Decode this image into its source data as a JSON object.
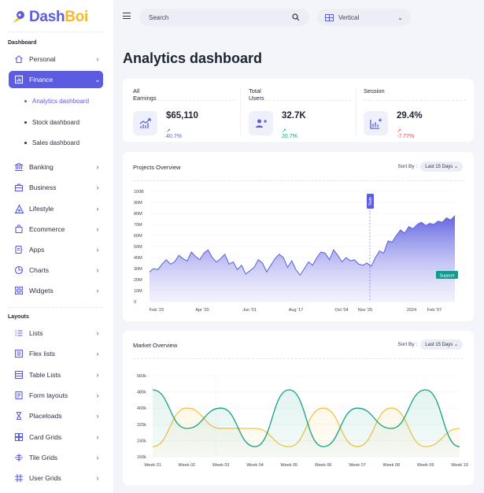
{
  "brand": {
    "name_main": "Dash",
    "name_accent": "Boi"
  },
  "sidebar": {
    "section_dashboard": "Dashboard",
    "section_layouts": "Layouts",
    "items": [
      {
        "label": "Personal",
        "icon": "home-icon"
      },
      {
        "label": "Finance",
        "icon": "chart-box-icon"
      },
      {
        "label": "Banking",
        "icon": "bank-icon"
      },
      {
        "label": "Business",
        "icon": "briefcase-icon"
      },
      {
        "label": "Lifestyle",
        "icon": "puzzle-icon"
      },
      {
        "label": "Ecommerce",
        "icon": "bag-icon"
      },
      {
        "label": "Apps",
        "icon": "apps-icon"
      },
      {
        "label": "Charts",
        "icon": "pie-icon"
      },
      {
        "label": "Widgets",
        "icon": "widgets-icon"
      }
    ],
    "finance_sub": [
      {
        "label": "Analytics dashboard"
      },
      {
        "label": "Stock dashboard"
      },
      {
        "label": "Sales dashboard"
      }
    ],
    "layout_items": [
      {
        "label": "Lists",
        "icon": "list-icon"
      },
      {
        "label": "Flex lists",
        "icon": "flex-list-icon"
      },
      {
        "label": "Table Lists",
        "icon": "table-icon"
      },
      {
        "label": "Form layouts",
        "icon": "form-icon"
      },
      {
        "label": "Placeloads",
        "icon": "hourglass-icon"
      },
      {
        "label": "Card Grids",
        "icon": "card-grid-icon"
      },
      {
        "label": "Tile Grids",
        "icon": "tile-grid-icon"
      },
      {
        "label": "User Grids",
        "icon": "user-grid-icon"
      }
    ]
  },
  "topbar": {
    "search_placeholder": "Search",
    "layout_value": "Vertical"
  },
  "page_title": "Analytics dashboard",
  "stats": [
    {
      "title": "All Earnings",
      "value": "$65,110",
      "change": "40.7%",
      "trend": "up",
      "color": "#5b5ce0"
    },
    {
      "title": "Total Users",
      "value": "32.7K",
      "change": "20.7%",
      "trend": "up",
      "color": "#1aa37a"
    },
    {
      "title": "Session",
      "value": "29.4%",
      "change": "-7.77%",
      "trend": "down",
      "color": "#ef4d4d"
    }
  ],
  "projects": {
    "title": "Projects Overview",
    "sort_label": "Sort By :",
    "sort_value": "Last 15 Days",
    "annotation_sale": "Sale",
    "annotation_support": "Support",
    "y_ticks": [
      "100B",
      "90M",
      "80M",
      "70M",
      "60M",
      "50M",
      "40M",
      "30M",
      "20M",
      "10M",
      "0"
    ],
    "x_ticks": [
      "Feb '23",
      "Apr '20",
      "Jun '01",
      "Aug '17",
      "Oct '04",
      "Nov '25",
      "2024",
      "Feb '07"
    ]
  },
  "market": {
    "title": "Market Overview",
    "sort_label": "Sort By :",
    "sort_value": "Last 15 Days",
    "y_ticks": [
      "560k",
      "480k",
      "400k",
      "320k",
      "240k",
      "160k"
    ],
    "x_ticks": [
      "Week 01",
      "Week 02",
      "Week 03",
      "Week 04",
      "Week 05",
      "Week 06",
      "Week 07",
      "Week 08",
      "Week 09",
      "Week 10"
    ]
  },
  "chart_data": [
    {
      "type": "area",
      "title": "Projects Overview",
      "ylim": [
        0,
        100
      ],
      "y_unit": "M",
      "x_labels": [
        "Feb '23",
        "Apr '20",
        "Jun '01",
        "Aug '17",
        "Oct '04",
        "Nov '25",
        "2024",
        "Feb '07"
      ],
      "values": [
        27,
        30,
        29,
        34,
        38,
        34,
        36,
        42,
        39,
        37,
        45,
        41,
        38,
        44,
        47,
        40,
        36,
        39,
        43,
        34,
        36,
        29,
        33,
        25,
        28,
        31,
        38,
        35,
        27,
        33,
        39,
        43,
        40,
        31,
        37,
        29,
        24,
        30,
        36,
        33,
        40,
        45,
        44,
        38,
        47,
        42,
        36,
        40,
        37,
        38,
        34,
        33,
        35,
        32,
        40,
        46,
        44,
        55,
        54,
        60,
        65,
        62,
        68,
        66,
        70,
        72,
        69,
        71,
        70,
        73,
        72,
        76,
        74,
        78
      ]
    },
    {
      "type": "area",
      "title": "Market Overview",
      "ylim": [
        160,
        560
      ],
      "y_unit": "k",
      "categories": [
        "Week 01",
        "Week 02",
        "Week 03",
        "Week 04",
        "Week 05",
        "Week 06",
        "Week 07",
        "Week 08",
        "Week 09",
        "Week 10"
      ],
      "series": [
        {
          "color": "#17a085",
          "values": [
            490,
            300,
            400,
            210,
            490,
            210,
            400,
            300,
            490,
            210
          ]
        },
        {
          "color": "#f2c44a",
          "values": [
            210,
            400,
            300,
            300,
            210,
            400,
            210,
            400,
            210,
            300
          ]
        }
      ]
    }
  ]
}
